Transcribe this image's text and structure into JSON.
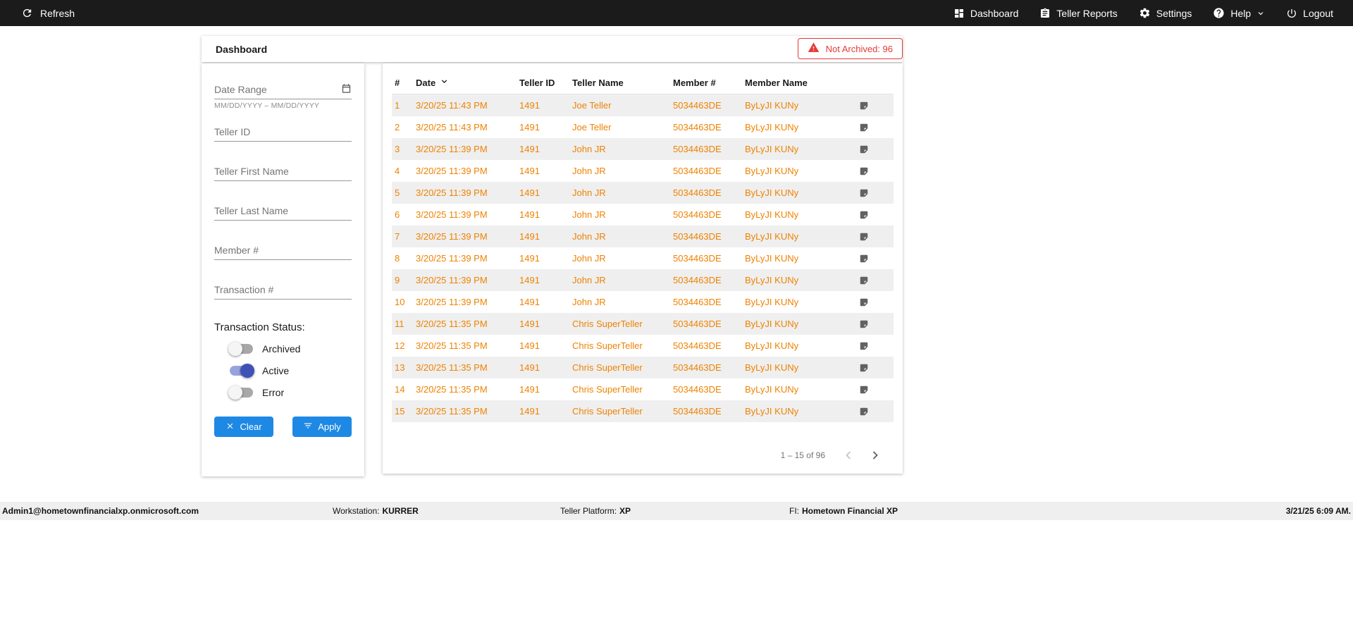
{
  "colors": {
    "topbar_bg": "#1b1b1b",
    "accent_blue": "#1e88e5",
    "row_orange": "#ef8200",
    "alert_red": "#e53935",
    "toggle_on": "#3f51b5",
    "footer_bg": "#efefef",
    "row_alt_bg": "#efefef"
  },
  "topnav": {
    "refresh_label": "Refresh",
    "items": [
      {
        "label": "Dashboard",
        "icon": "dashboard-icon"
      },
      {
        "label": "Teller Reports",
        "icon": "reports-icon"
      },
      {
        "label": "Settings",
        "icon": "settings-icon"
      },
      {
        "label": "Help",
        "icon": "help-icon",
        "has_caret": true
      },
      {
        "label": "Logout",
        "icon": "logout-icon"
      }
    ]
  },
  "header": {
    "title": "Dashboard",
    "badge_label": "Not Archived: 96"
  },
  "filters": {
    "fields": [
      {
        "placeholder": "Date Range",
        "hint": "MM/DD/YYYY – MM/DD/YYYY",
        "icon": "calendar-icon"
      },
      {
        "placeholder": "Teller ID"
      },
      {
        "placeholder": "Teller First Name"
      },
      {
        "placeholder": "Teller Last Name"
      },
      {
        "placeholder": "Member #"
      },
      {
        "placeholder": "Transaction #"
      }
    ],
    "status_label": "Transaction Status:",
    "toggles": [
      {
        "label": "Archived",
        "on": false
      },
      {
        "label": "Active",
        "on": true
      },
      {
        "label": "Error",
        "on": false
      }
    ],
    "clear_label": "Clear",
    "apply_label": "Apply"
  },
  "table": {
    "columns": [
      "#",
      "Date",
      "Teller ID",
      "Teller Name",
      "Member #",
      "Member Name",
      ""
    ],
    "sort": {
      "column": "Date",
      "direction": "desc"
    },
    "rows": [
      {
        "num": "1",
        "date": "3/20/25 11:43 PM",
        "teller_id": "1491",
        "teller_name": "Joe Teller",
        "member_num": "5034463DE",
        "member_name": "ByLyJI KUNy"
      },
      {
        "num": "2",
        "date": "3/20/25 11:43 PM",
        "teller_id": "1491",
        "teller_name": "Joe Teller",
        "member_num": "5034463DE",
        "member_name": "ByLyJI KUNy"
      },
      {
        "num": "3",
        "date": "3/20/25 11:39 PM",
        "teller_id": "1491",
        "teller_name": "John JR",
        "member_num": "5034463DE",
        "member_name": "ByLyJI KUNy"
      },
      {
        "num": "4",
        "date": "3/20/25 11:39 PM",
        "teller_id": "1491",
        "teller_name": "John JR",
        "member_num": "5034463DE",
        "member_name": "ByLyJI KUNy"
      },
      {
        "num": "5",
        "date": "3/20/25 11:39 PM",
        "teller_id": "1491",
        "teller_name": "John JR",
        "member_num": "5034463DE",
        "member_name": "ByLyJI KUNy"
      },
      {
        "num": "6",
        "date": "3/20/25 11:39 PM",
        "teller_id": "1491",
        "teller_name": "John JR",
        "member_num": "5034463DE",
        "member_name": "ByLyJI KUNy"
      },
      {
        "num": "7",
        "date": "3/20/25 11:39 PM",
        "teller_id": "1491",
        "teller_name": "John JR",
        "member_num": "5034463DE",
        "member_name": "ByLyJI KUNy"
      },
      {
        "num": "8",
        "date": "3/20/25 11:39 PM",
        "teller_id": "1491",
        "teller_name": "John JR",
        "member_num": "5034463DE",
        "member_name": "ByLyJI KUNy"
      },
      {
        "num": "9",
        "date": "3/20/25 11:39 PM",
        "teller_id": "1491",
        "teller_name": "John JR",
        "member_num": "5034463DE",
        "member_name": "ByLyJI KUNy"
      },
      {
        "num": "10",
        "date": "3/20/25 11:39 PM",
        "teller_id": "1491",
        "teller_name": "John JR",
        "member_num": "5034463DE",
        "member_name": "ByLyJI KUNy"
      },
      {
        "num": "11",
        "date": "3/20/25 11:35 PM",
        "teller_id": "1491",
        "teller_name": "Chris SuperTeller",
        "member_num": "5034463DE",
        "member_name": "ByLyJI KUNy"
      },
      {
        "num": "12",
        "date": "3/20/25 11:35 PM",
        "teller_id": "1491",
        "teller_name": "Chris SuperTeller",
        "member_num": "5034463DE",
        "member_name": "ByLyJI KUNy"
      },
      {
        "num": "13",
        "date": "3/20/25 11:35 PM",
        "teller_id": "1491",
        "teller_name": "Chris SuperTeller",
        "member_num": "5034463DE",
        "member_name": "ByLyJI KUNy"
      },
      {
        "num": "14",
        "date": "3/20/25 11:35 PM",
        "teller_id": "1491",
        "teller_name": "Chris SuperTeller",
        "member_num": "5034463DE",
        "member_name": "ByLyJI KUNy"
      },
      {
        "num": "15",
        "date": "3/20/25 11:35 PM",
        "teller_id": "1491",
        "teller_name": "Chris SuperTeller",
        "member_num": "5034463DE",
        "member_name": "ByLyJI KUNy"
      }
    ],
    "row_note_icon": "note-icon",
    "pagination": {
      "range_label": "1 – 15 of 96"
    }
  },
  "footer": {
    "user": "Admin1@hometownfinancialxp.onmicrosoft.com",
    "workstation_label": "Workstation:",
    "workstation_value": "KURRER",
    "platform_label": "Teller Platform:",
    "platform_value": "XP",
    "fi_label": "FI:",
    "fi_value": "Hometown Financial XP",
    "datetime": "3/21/25 6:09 AM."
  }
}
